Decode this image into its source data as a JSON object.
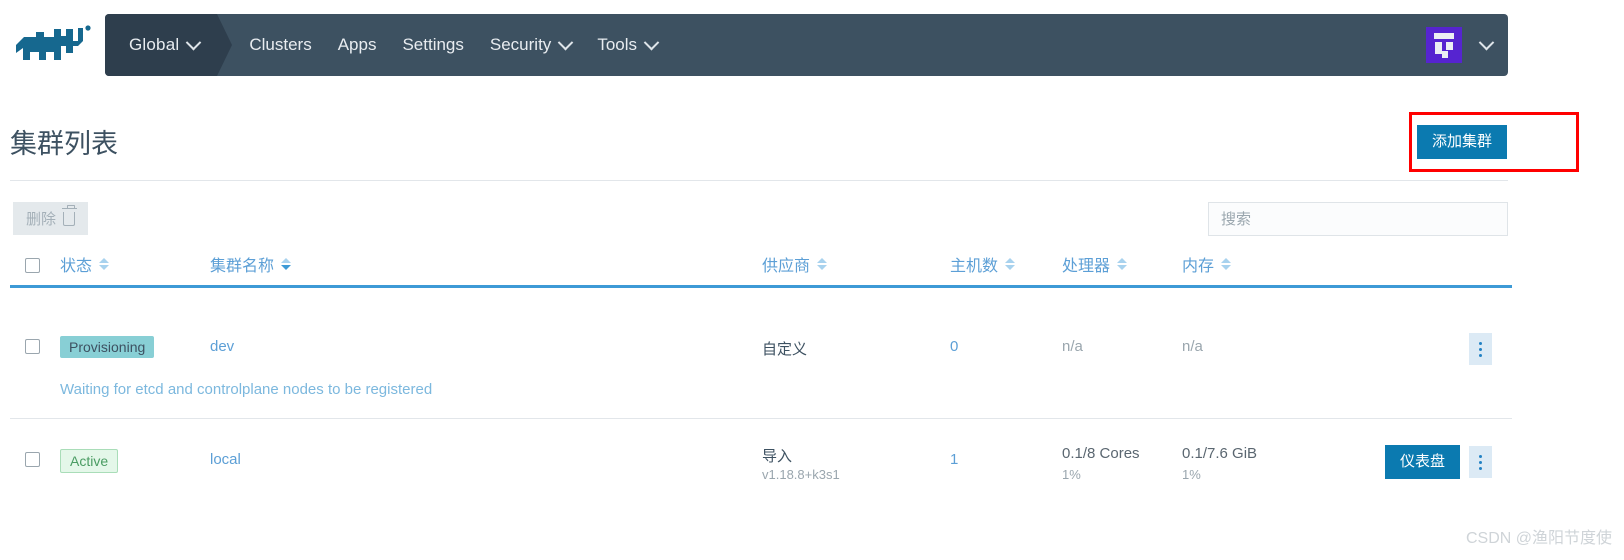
{
  "nav": {
    "logo_icon": "rancher-cow-logo-icon",
    "context": {
      "label": "Global",
      "icon": "chevron-down-icon"
    },
    "items": [
      {
        "label": "Clusters",
        "has_caret": false
      },
      {
        "label": "Apps",
        "has_caret": false
      },
      {
        "label": "Settings",
        "has_caret": false
      },
      {
        "label": "Security",
        "has_caret": true
      },
      {
        "label": "Tools",
        "has_caret": true
      }
    ],
    "avatar_icon": "user-avatar",
    "avatar_caret_icon": "chevron-down-icon",
    "avatar_color": "#5624d0",
    "bar_color": "#3d5161",
    "context_color": "#2e3e4d"
  },
  "header": {
    "title": "集群列表",
    "add_button": "添加集群",
    "add_button_color": "#0b7ab0",
    "highlight_color": "#ff0000"
  },
  "toolbar": {
    "delete_label": "删除",
    "delete_icon": "trash-icon",
    "search_placeholder": "搜索",
    "search_value": ""
  },
  "table": {
    "select_all_icon": "checkbox-unchecked",
    "columns": [
      {
        "label": "状态",
        "sortable": true,
        "active": false
      },
      {
        "label": "集群名称",
        "sortable": true,
        "active": true
      },
      {
        "label": "供应商",
        "sortable": true,
        "active": false
      },
      {
        "label": "主机数",
        "sortable": true,
        "active": false
      },
      {
        "label": "处理器",
        "sortable": true,
        "active": false
      },
      {
        "label": "内存",
        "sortable": true,
        "active": false
      }
    ],
    "header_underline_color": "#3d9ad6",
    "rows": [
      {
        "checkbox_icon": "checkbox-unchecked",
        "status": "Provisioning",
        "status_kind": "provisioning",
        "name": "dev",
        "provider": "自定义",
        "provider_version": "",
        "nodes": "0",
        "cpu": "n/a",
        "cpu_pct": "",
        "memory": "n/a",
        "memory_pct": "",
        "message": "Waiting for etcd and controlplane nodes to be registered",
        "dashboard_button": "",
        "kebab_icon": "kebab-menu-icon"
      },
      {
        "checkbox_icon": "checkbox-unchecked",
        "status": "Active",
        "status_kind": "active",
        "name": "local",
        "provider": "导入",
        "provider_version": "v1.18.8+k3s1",
        "nodes": "1",
        "cpu": "0.1/8 Cores",
        "cpu_pct": "1%",
        "memory": "0.1/7.6 GiB",
        "memory_pct": "1%",
        "message": "",
        "dashboard_button": "仪表盘",
        "kebab_icon": "kebab-menu-icon"
      }
    ]
  },
  "watermark": "CSDN @渔阳节度使"
}
